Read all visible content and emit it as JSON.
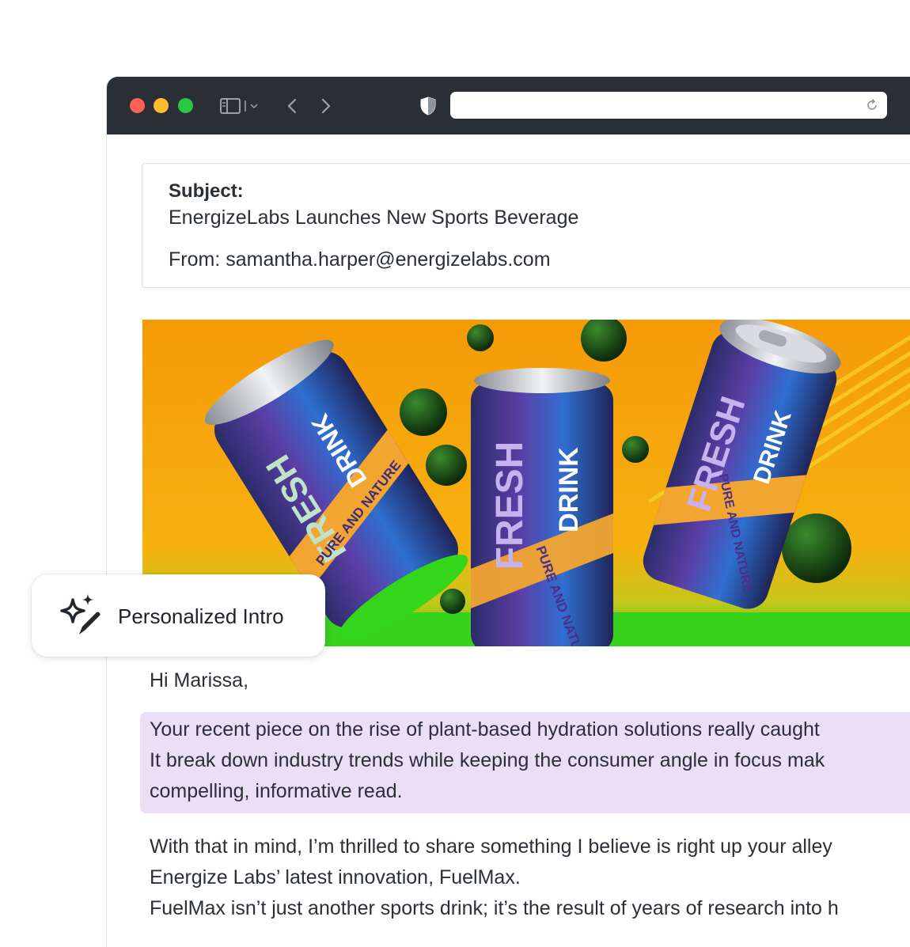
{
  "browser": {
    "url": "",
    "icons": [
      "sidebar-icon",
      "chevron-down-icon",
      "back-icon",
      "forward-icon",
      "shield-icon",
      "reload-icon"
    ]
  },
  "email": {
    "subject_label": "Subject:",
    "subject": "EnergizeLabs Launches New Sports Beverage",
    "from": "From: samantha.harper@energizelabs.com",
    "hero_image": {
      "can_left": {
        "brand": "FRESH",
        "word2": "DRINK",
        "tagline": "PURE AND NATURE"
      },
      "can_middle": {
        "brand": "FRESH",
        "word2": "DRINK",
        "tagline": "PURE AND NATURE"
      },
      "can_right": {
        "brand": "FRESH",
        "word2": "DRINK",
        "tagline": "PURE AND NATURE"
      }
    },
    "greeting": "Hi Marissa,",
    "personalized_lines": [
      "Your recent piece on the rise of plant-based hydration solutions really caught",
      "It break down industry trends while keeping the consumer angle in focus mak",
      "compelling, informative read."
    ],
    "body_lines": [
      "With that in mind, I’m thrilled to share something I believe is right up your alley",
      "Energize Labs’ latest innovation, FuelMax.",
      "FuelMax isn’t just another sports drink; it’s the result of years of research into h"
    ]
  },
  "badge": {
    "label": "Personalized Intro",
    "icon": "sparkle-pen-icon"
  },
  "colors": {
    "titlebar": "#2a2f36",
    "highlight": "#ebdff7",
    "hero_bg": "#f6a20c",
    "hero_floor": "#35d11c"
  }
}
